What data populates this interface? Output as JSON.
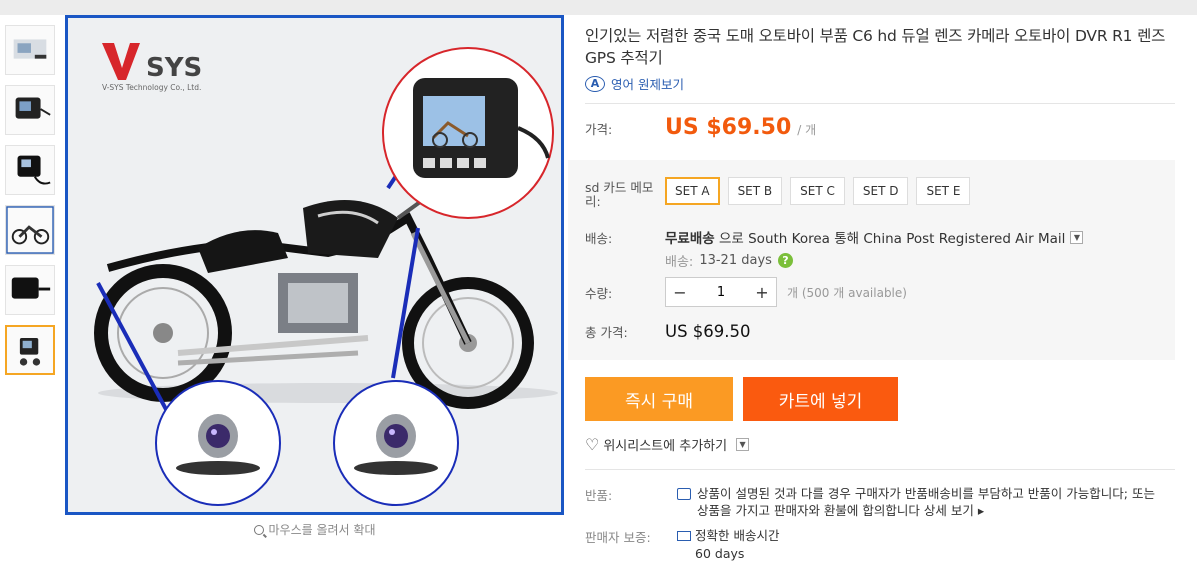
{
  "product": {
    "title": "인기있는 저렴한 중국 도매 오토바이 부품 C6 hd 듀얼 렌즈 카메라 오토바이 DVR R1 렌즈 GPS 추적기",
    "translate_label": "영어 원제보기"
  },
  "gallery": {
    "thumbnail_count": 6,
    "active_index": 5,
    "zoom_hint": "마우스를 올려서 확대",
    "brand_logo_text": "V-SYS Technology Co., Ltd."
  },
  "price": {
    "label": "가격:",
    "value": "US $69.50",
    "unit": "/ 개"
  },
  "sku": {
    "label": "sd 카드 메모리:",
    "options": [
      "SET A",
      "SET B",
      "SET C",
      "SET D",
      "SET E"
    ],
    "selected": "SET A"
  },
  "shipping": {
    "label": "배송:",
    "free": "무료배송",
    "via": "으로 South Korea 통해 China Post Registered Air Mail",
    "days_label": "배송:",
    "days_value": "13-21 days",
    "help_icon": "?"
  },
  "quantity": {
    "label": "수량:",
    "value": "1",
    "available": "개 (500 개 available)"
  },
  "total": {
    "label": "총 가격:",
    "value": "US $69.50"
  },
  "actions": {
    "buy_now": "즉시 구매",
    "add_to_cart": "카트에 넣기",
    "wishlist": "위시리스트에 추가하기"
  },
  "returns": {
    "label": "반품:",
    "text": "상품이 설명된 것과 다를 경우 구매자가 반품배송비를 부담하고 반품이 가능합니다; 또는 상품을 가지고 판매자와 환불에 합의합니다",
    "more": "상세 보기 ▸"
  },
  "guarantee": {
    "label": "판매자 보증:",
    "item": "정확한 배송시간",
    "days": "60 days"
  },
  "colors": {
    "price_orange": "#f25a0d",
    "buy_button": "#fb9a23",
    "cart_button": "#fa5a0f",
    "selected_border": "#f5a623",
    "image_border": "#1a56c4",
    "link_blue": "#2a5db0"
  }
}
